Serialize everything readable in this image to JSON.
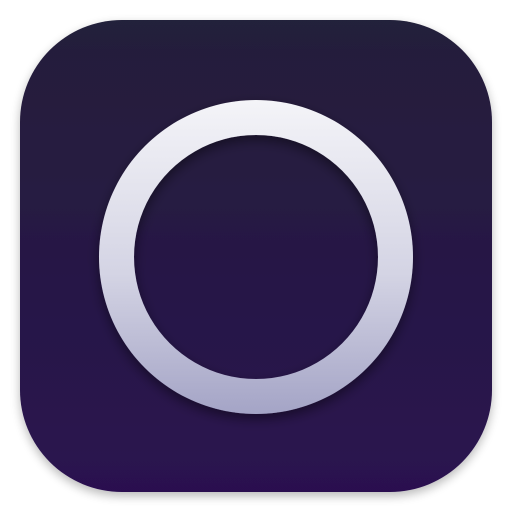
{
  "icon": {
    "name": "ring-app-icon",
    "glyph": "ring-icon",
    "colors": {
      "tile_top": "#24203a",
      "tile_bottom": "#2a1150",
      "ring_light": "#f4f4f8",
      "ring_mid": "#d4d4e4",
      "ring_dark": "#a4a4c6"
    }
  }
}
